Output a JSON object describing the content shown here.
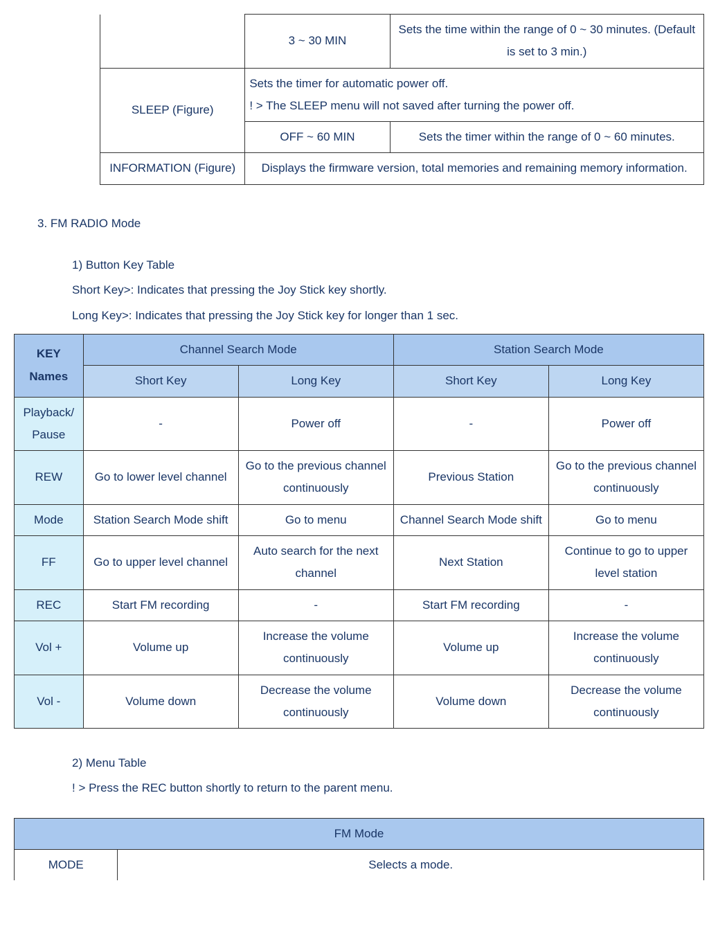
{
  "table1": {
    "row1": {
      "param": "3 ~ 30 MIN",
      "desc": "Sets the time within the range of 0 ~ 30 minutes. (Default is set to 3 min.)"
    },
    "row2": {
      "label": "SLEEP (Figure)",
      "note": "Sets the timer for automatic power off.",
      "warn": "! > The SLEEP menu will not saved after turning the power off."
    },
    "row3": {
      "param": "OFF ~ 60 MIN",
      "desc": "Sets the timer within the range of 0 ~ 60 minutes."
    },
    "row4": {
      "label": "INFORMATION (Figure)",
      "desc": "Displays the firmware version, total memories and remaining memory information."
    }
  },
  "section3": {
    "title": "3.   FM RADIO Mode",
    "sub1": "1)   Button Key Table",
    "shortkey_note": "Short Key>: Indicates that pressing the Joy Stick key shortly.",
    "longkey_note": "Long Key>: Indicates that pressing the Joy Stick key for longer than 1 sec.",
    "sub2": "2)   Menu Table",
    "menu_note": "! > Press the REC button shortly to return to the parent menu."
  },
  "table2": {
    "keyhdr": "KEY Names",
    "group1": "Channel Search Mode",
    "group2": "Station Search Mode",
    "sub1": "Short Key",
    "sub2": "Long Key",
    "sub3": "Short Key",
    "sub4": "Long Key",
    "rows": [
      {
        "k": "Playback/ Pause",
        "a": "-",
        "b": "Power off",
        "c": "-",
        "d": "Power off"
      },
      {
        "k": "REW",
        "a": "Go to lower level channel",
        "b": "Go to the previous channel continuously",
        "c": "Previous Station",
        "d": "Go to the previous channel continuously"
      },
      {
        "k": "Mode",
        "a": "Station Search Mode shift",
        "b": "Go to menu",
        "c": "Channel Search Mode shift",
        "d": "Go to menu"
      },
      {
        "k": "FF",
        "a": "Go to upper level channel",
        "b": "Auto search for the next channel",
        "c": "Next Station",
        "d": "Continue to go to upper level station"
      },
      {
        "k": "REC",
        "a": "Start FM recording",
        "b": "-",
        "c": "Start FM recording",
        "d": "-"
      },
      {
        "k": "Vol +",
        "a": "Volume up",
        "b": "Increase the volume continuously",
        "c": "Volume up",
        "d": "Increase the volume continuously"
      },
      {
        "k": "Vol -",
        "a": "Volume down",
        "b": "Decrease the volume continuously",
        "c": "Volume down",
        "d": "Decrease the volume continuously"
      }
    ]
  },
  "table3": {
    "hdr": "FM Mode",
    "mode": "MODE",
    "mode_desc": "Selects a mode."
  }
}
